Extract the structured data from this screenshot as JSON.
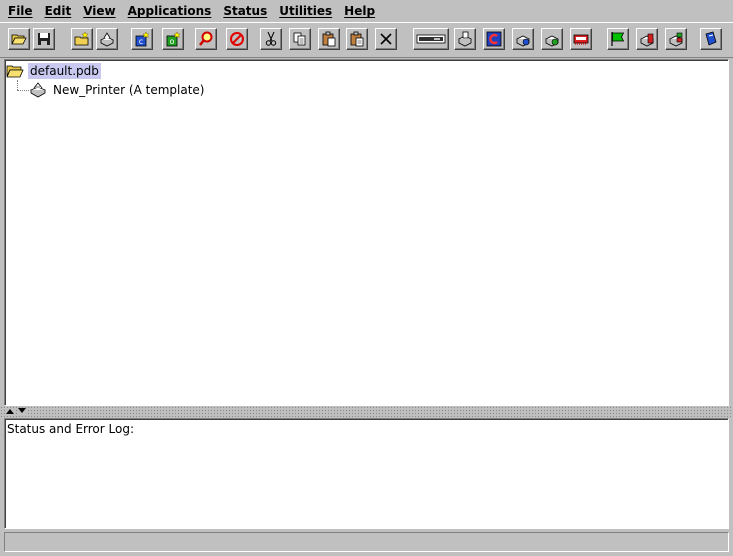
{
  "menubar": {
    "items": [
      {
        "label": "File",
        "name": "menu-file"
      },
      {
        "label": "Edit",
        "name": "menu-edit"
      },
      {
        "label": "View",
        "name": "menu-view"
      },
      {
        "label": "Applications",
        "name": "menu-applications"
      },
      {
        "label": "Status",
        "name": "menu-status"
      },
      {
        "label": "Utilities",
        "name": "menu-utilities"
      },
      {
        "label": "Help",
        "name": "menu-help"
      }
    ]
  },
  "toolbar": {
    "buttons": [
      {
        "icon": "open-folder-icon"
      },
      {
        "icon": "save-disk-icon"
      },
      {
        "icon": "new-folder-icon"
      },
      {
        "icon": "new-printer-icon"
      },
      {
        "icon": "new-class-icon"
      },
      {
        "icon": "new-object-icon"
      },
      {
        "icon": "find-icon"
      },
      {
        "icon": "stop-icon"
      },
      {
        "icon": "cut-icon"
      },
      {
        "icon": "copy-icon"
      },
      {
        "icon": "paste-icon"
      },
      {
        "icon": "paste-special-icon"
      },
      {
        "icon": "delete-icon"
      },
      {
        "icon": "device-icon"
      },
      {
        "icon": "printer-settings-icon"
      },
      {
        "icon": "compile-icon"
      },
      {
        "icon": "printer-config-icon"
      },
      {
        "icon": "printer-download-icon"
      },
      {
        "icon": "network-card-icon"
      },
      {
        "icon": "flag-icon"
      },
      {
        "icon": "printer-hold-icon"
      },
      {
        "icon": "printer-release-icon"
      },
      {
        "icon": "help-book-icon"
      }
    ]
  },
  "tree": {
    "root_label": "default.pdb",
    "child_label": "New_Printer (A template)"
  },
  "log": {
    "label": "Status and Error Log:"
  },
  "statusbar": {
    "text": ""
  }
}
